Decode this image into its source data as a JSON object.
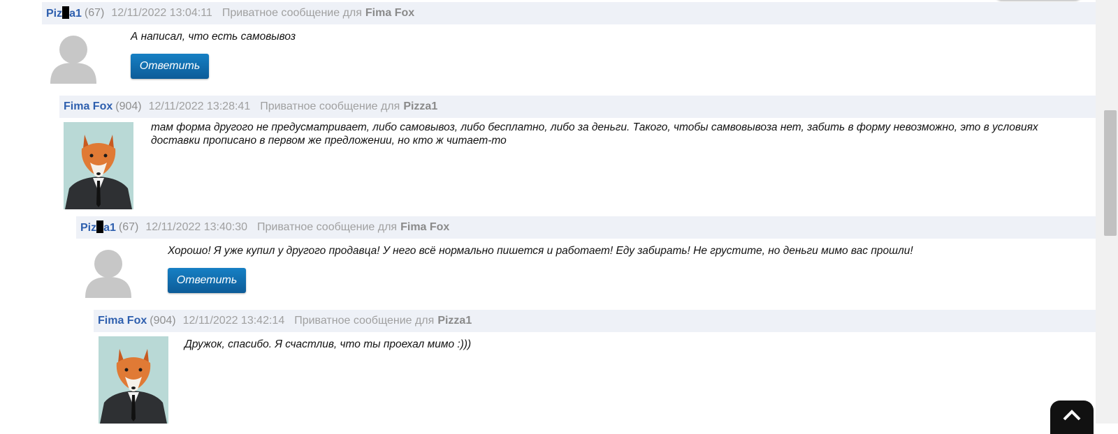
{
  "private_message_label": "Приватное сообщение для",
  "reply_label": "Ответить",
  "comments": [
    {
      "author_prefix": "Piz",
      "author_suffix": "a1",
      "rating": "(67)",
      "date": "12/11/2022 13:04:11",
      "recipient": "Fima Fox",
      "text": "А написал, что есть самовывоз",
      "avatar": "default-user-icon"
    },
    {
      "author": "Fima Fox",
      "rating": "(904)",
      "date": "12/11/2022 13:28:41",
      "recipient": "Pizza1",
      "text": "там форма другого не предусматривает, либо самовывоз, либо бесплатно, либо за деньги. Такого, чтобы самвовывоза нет, забить в форму невозможно, это в условиях доставки прописано в первом же предложении, но кто ж читает-то",
      "avatar": "fox-in-suit-photo"
    },
    {
      "author_prefix": "Piz",
      "author_suffix": "a1",
      "rating": "(67)",
      "date": "12/11/2022 13:40:30",
      "recipient": "Fima Fox",
      "text": "Хорошо! Я уже купил у другого продавца! У него всё нормально пишется и работает! Еду забирать! Не грустите, но деньги мимо вас прошли!",
      "avatar": "default-user-icon"
    },
    {
      "author": "Fima Fox",
      "rating": "(904)",
      "date": "12/11/2022 13:42:14",
      "recipient": "Pizza1",
      "text": "Дружок, спасибо. Я счастлив, что ты проехал мимо :)))",
      "avatar": "fox-in-suit-photo"
    }
  ],
  "icons": {
    "scroll_top": "chevron-up-icon"
  }
}
